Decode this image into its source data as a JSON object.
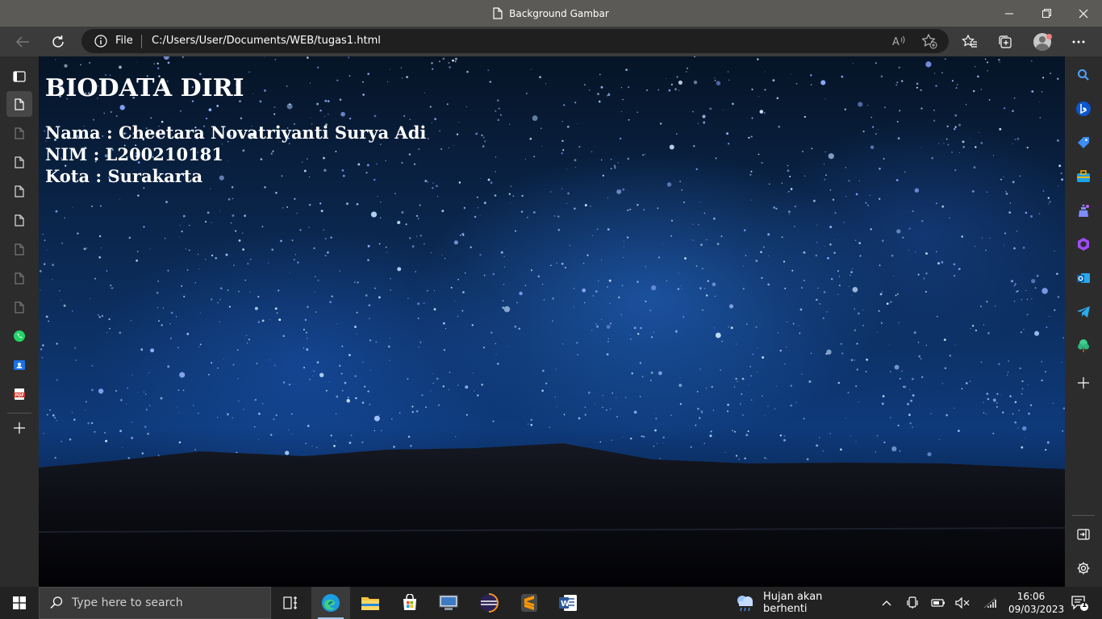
{
  "window": {
    "title": "Background Gambar"
  },
  "address_bar": {
    "scheme_label": "File",
    "url": "C:/Users/User/Documents/WEB/tugas1.html"
  },
  "page": {
    "heading": "BIODATA DIRI",
    "rows": [
      {
        "text": "Nama : Cheetara Novatriyanti Surya Adi"
      },
      {
        "text": "NIM : L200210181"
      },
      {
        "text": "Kota : Surakarta"
      }
    ],
    "background": "starry-night-sky"
  },
  "left_sidebar": {
    "tabs": [
      "tab-actions-icon",
      "page-icon",
      "page-icon",
      "page-icon",
      "page-icon",
      "page-icon",
      "page-icon",
      "page-icon",
      "page-icon",
      "whatsapp-icon",
      "contacts-icon",
      "pdf-icon"
    ],
    "new_tab": "plus-icon"
  },
  "right_sidebar": {
    "items": [
      "search-icon",
      "bing-icon",
      "shopping-icon",
      "tools-icon",
      "games-icon",
      "office-icon",
      "outlook-icon",
      "telegram-icon",
      "tree-icon",
      "plus-icon"
    ],
    "bottom": [
      "sidebar-toggle-icon",
      "settings-icon"
    ]
  },
  "taskbar": {
    "search_placeholder": "Type here to search",
    "apps": [
      "task-view-icon",
      "edge-icon",
      "file-explorer-icon",
      "store-icon",
      "remote-desktop-icon",
      "eclipse-icon",
      "sublime-text-icon",
      "word-icon"
    ],
    "weather_text": "Hujan akan berhenti",
    "time": "16:06",
    "date": "09/03/2023",
    "notification_count": "1"
  },
  "colors": {
    "titlebar": "#5b5a56",
    "toolbar": "#3b3b3b",
    "sidebar": "#2c2c2c",
    "taskbar": "#222222",
    "text": "#ffffff"
  }
}
